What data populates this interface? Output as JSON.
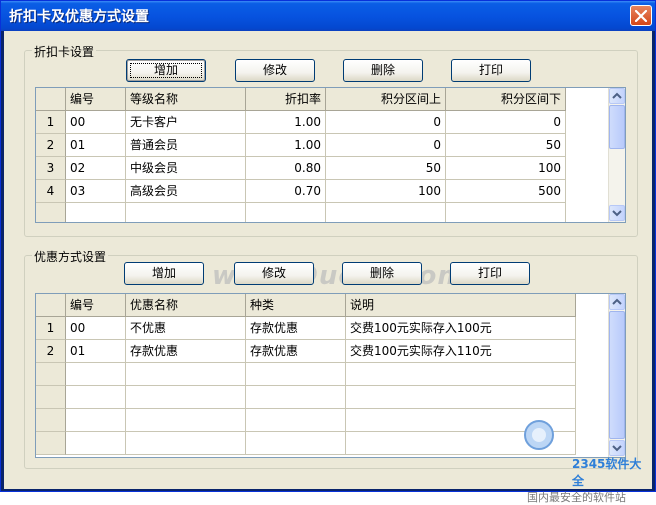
{
  "window": {
    "title": "折扣卡及优惠方式设置"
  },
  "discount_group": {
    "legend": "折扣卡设置",
    "buttons": {
      "add": "增加",
      "edit": "修改",
      "delete": "删除",
      "print": "打印"
    },
    "columns": [
      "编号",
      "等级名称",
      "折扣率",
      "积分区间上",
      "积分区间下"
    ],
    "rows": [
      {
        "num": "1",
        "code": "00",
        "name": "无卡客户",
        "rate": "1.00",
        "upper": "0",
        "lower": "0"
      },
      {
        "num": "2",
        "code": "01",
        "name": "普通会员",
        "rate": "1.00",
        "upper": "0",
        "lower": "50"
      },
      {
        "num": "3",
        "code": "02",
        "name": "中级会员",
        "rate": "0.80",
        "upper": "50",
        "lower": "100"
      },
      {
        "num": "4",
        "code": "03",
        "name": "高级会员",
        "rate": "0.70",
        "upper": "100",
        "lower": "500"
      }
    ]
  },
  "promo_group": {
    "legend": "优惠方式设置",
    "buttons": {
      "add": "增加",
      "edit": "修改",
      "delete": "删除",
      "print": "打印"
    },
    "columns": [
      "编号",
      "优惠名称",
      "种类",
      "说明"
    ],
    "rows": [
      {
        "num": "1",
        "code": "00",
        "name": "不优惠",
        "type": "存款优惠",
        "desc": "交费100元实际存入100元"
      },
      {
        "num": "2",
        "code": "01",
        "name": "存款优惠",
        "type": "存款优惠",
        "desc": "交费100元实际存入110元"
      }
    ]
  },
  "watermark": "www.DuoTe.com",
  "logo": {
    "text": "2345软件大全",
    "slogan": "国内最安全的软件站"
  },
  "icons": {
    "close": "close-icon",
    "scroll_up": "arrow-up-icon",
    "scroll_down": "arrow-down-icon"
  },
  "colors": {
    "titlebar": "#0753e0",
    "client": "#ece9d8",
    "close": "#d34618"
  }
}
